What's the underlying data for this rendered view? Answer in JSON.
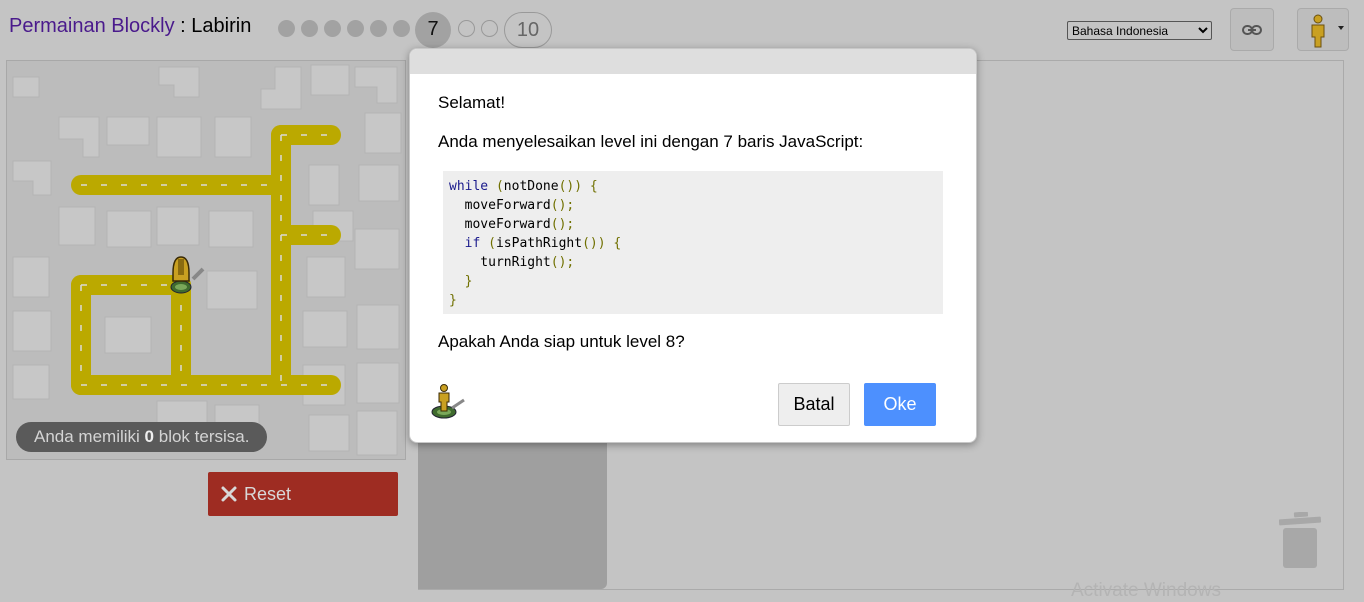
{
  "header": {
    "app_title": "Permainan Blockly",
    "separator": " : ",
    "game_title": "Labirin",
    "levels": [
      {
        "label": "",
        "state": "done"
      },
      {
        "label": "",
        "state": "done"
      },
      {
        "label": "",
        "state": "done"
      },
      {
        "label": "",
        "state": "done"
      },
      {
        "label": "",
        "state": "done"
      },
      {
        "label": "",
        "state": "done"
      },
      {
        "label": "7",
        "state": "current"
      },
      {
        "label": "",
        "state": "future"
      },
      {
        "label": "",
        "state": "future"
      },
      {
        "label": "10",
        "state": "last"
      }
    ],
    "language": "Bahasa Indonesia",
    "link_icon": "link-icon",
    "avatar_icon": "pegman-icon"
  },
  "maze": {
    "capacity_prefix": "Anda memiliki ",
    "capacity_count": "0",
    "capacity_suffix": " blok tersisa.",
    "reset_label": "Reset"
  },
  "dialog": {
    "greeting": "Selamat!",
    "message": "Anda menyelesaikan level ini dengan 7 baris JavaScript:",
    "code_lines": [
      "while (notDone()) {",
      "  moveForward();",
      "  moveForward();",
      "  if (isPathRight()) {",
      "    turnRight();",
      "  }",
      "}"
    ],
    "question": "Apakah Anda siap untuk level 8?",
    "cancel_label": "Batal",
    "ok_label": "Oke"
  },
  "watermark": "Activate Windows",
  "colors": {
    "title_link": "#4a1a8c",
    "path": "#c8b400",
    "reset": "#9e2c22",
    "ok": "#4d90fe"
  }
}
